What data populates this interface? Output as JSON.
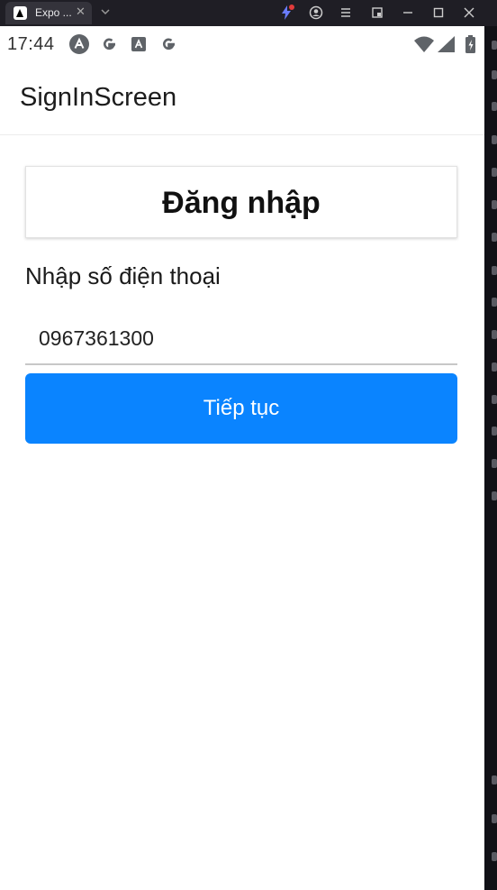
{
  "window": {
    "tab_title": "Expo ...",
    "tab_close": "✕"
  },
  "statusbar": {
    "time": "17:44"
  },
  "appbar": {
    "title": "SignInScreen"
  },
  "signin": {
    "heading": "Đăng nhập",
    "phone_label": "Nhập số điện thoại",
    "phone_value": "0967361300",
    "continue_label": "Tiếp tục"
  },
  "colors": {
    "primary": "#0a84ff",
    "window_bg": "#1f1e25",
    "screen_bg": "#ffffff"
  }
}
